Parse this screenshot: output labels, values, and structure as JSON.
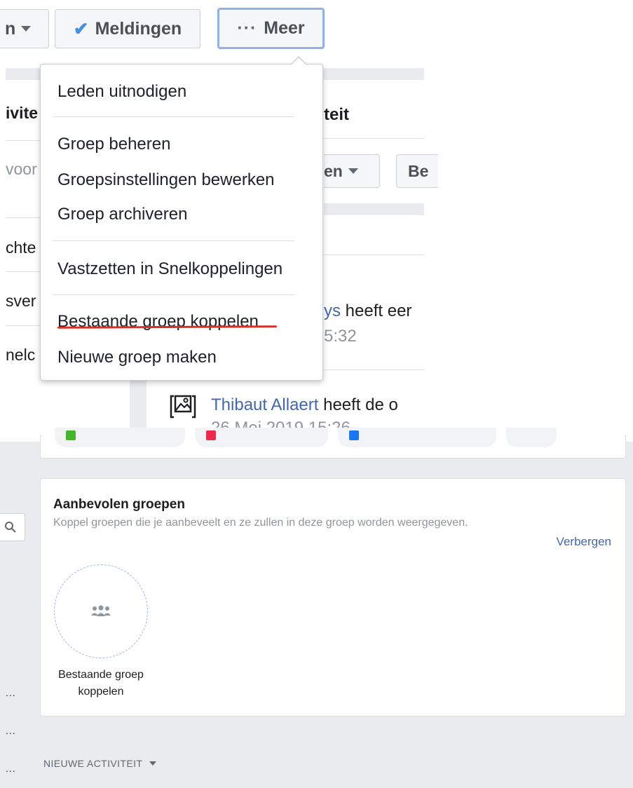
{
  "top_bar": {
    "left_button_label": "n",
    "notifications_label": "Meldingen",
    "more_label": "Meer",
    "more_dots": "···"
  },
  "background": {
    "left_fragments": [
      "ivite",
      "voor",
      "chte",
      "sver",
      "nelc"
    ],
    "activity_heading": "teit",
    "filter_button": "en",
    "second_button": "Be",
    "post1_link": "ys",
    "post1_text": "heeft eer",
    "post1_time": "5:32",
    "post2_link": "Thibaut Allaert",
    "post2_text": "heeft de o",
    "post2_time": "26 Mei 2019 15:26"
  },
  "dropdown": {
    "group1": [
      "Leden uitnodigen"
    ],
    "group2": [
      "Groep beheren",
      "Groepsinstellingen bewerken",
      "Groep archiveren"
    ],
    "group3": [
      "Vastzetten in Snelkoppelingen"
    ],
    "group4": [
      "Bestaande groep koppelen",
      "Nieuwe groep maken"
    ]
  },
  "recommended": {
    "title": "Aanbevolen groepen",
    "subtitle": "Koppel groepen die je aanbeveelt en ze zullen in deze groep worden weergegeven.",
    "hide_link": "Verbergen",
    "card_label": "Bestaande groep koppelen"
  },
  "footer": {
    "new_activity_label": "NIEUWE ACTIVITEIT",
    "ellipses": [
      "...",
      "...",
      "..."
    ]
  },
  "colors": {
    "link_blue": "#4267b2",
    "check_blue": "#4a90e2",
    "underline_red": "#d93025",
    "page_gray": "#e9ebee"
  },
  "icons": [
    "check-icon",
    "caret-down-icon",
    "photo-icon",
    "group-icon",
    "search-icon"
  ]
}
